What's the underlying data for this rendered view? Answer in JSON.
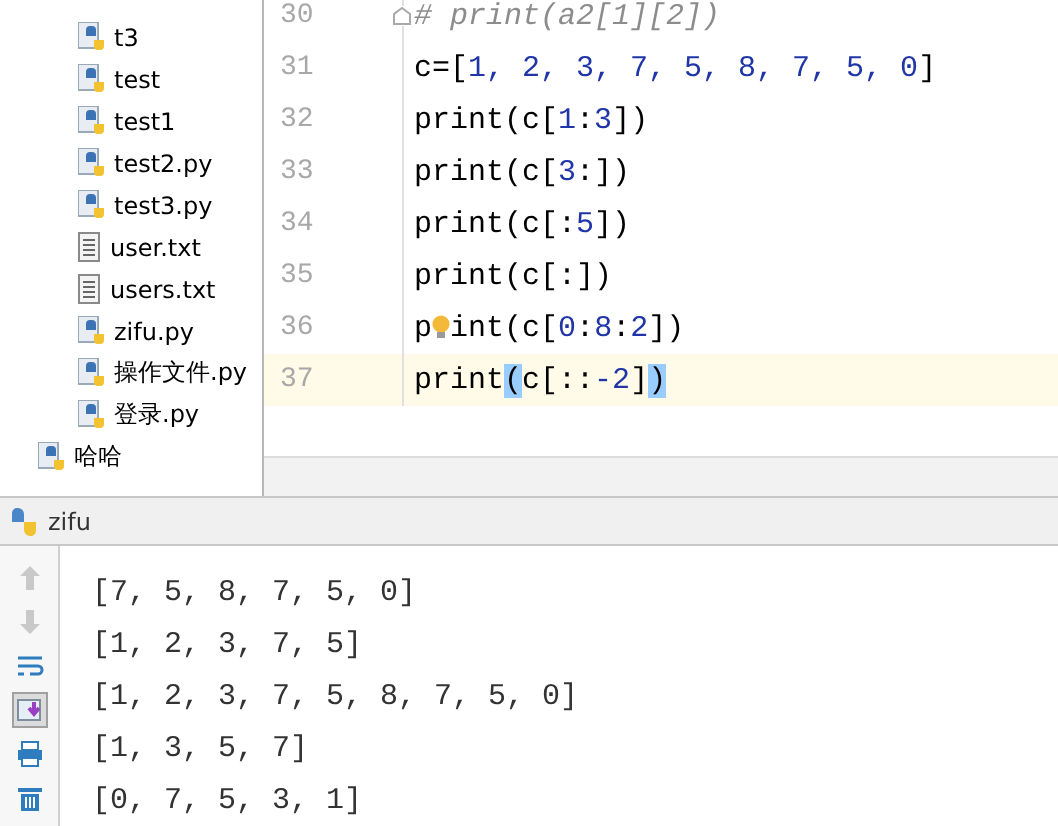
{
  "project_tree": {
    "files": [
      {
        "label": "t3",
        "kind": "python"
      },
      {
        "label": "test",
        "kind": "python"
      },
      {
        "label": "test1",
        "kind": "python"
      },
      {
        "label": "test2.py",
        "kind": "python"
      },
      {
        "label": "test3.py",
        "kind": "python"
      },
      {
        "label": "user.txt",
        "kind": "text"
      },
      {
        "label": "users.txt",
        "kind": "text"
      },
      {
        "label": "zifu.py",
        "kind": "python"
      },
      {
        "label": "操作文件.py",
        "kind": "python"
      },
      {
        "label": "登录.py",
        "kind": "python"
      }
    ],
    "packages": [
      {
        "label": "哈哈",
        "kind": "python"
      }
    ]
  },
  "editor": {
    "lines": [
      {
        "number": "30",
        "current": false,
        "fold": true,
        "tokens": [
          {
            "kind": "comment",
            "text": "# print(a2[1][2])"
          }
        ]
      },
      {
        "number": "31",
        "current": false,
        "fold": false,
        "tokens": [
          {
            "kind": "plain",
            "text": "c=["
          },
          {
            "kind": "number",
            "text": "1, 2, 3, 7, 5, 8, 7, 5, 0"
          },
          {
            "kind": "plain",
            "text": "]"
          }
        ]
      },
      {
        "number": "32",
        "current": false,
        "fold": false,
        "tokens": [
          {
            "kind": "plain",
            "text": "print(c["
          },
          {
            "kind": "number",
            "text": "1"
          },
          {
            "kind": "plain",
            "text": ":"
          },
          {
            "kind": "number",
            "text": "3"
          },
          {
            "kind": "plain",
            "text": "])"
          }
        ]
      },
      {
        "number": "33",
        "current": false,
        "fold": false,
        "tokens": [
          {
            "kind": "plain",
            "text": "print(c["
          },
          {
            "kind": "number",
            "text": "3"
          },
          {
            "kind": "plain",
            "text": ":])"
          }
        ]
      },
      {
        "number": "34",
        "current": false,
        "fold": false,
        "tokens": [
          {
            "kind": "plain",
            "text": "print(c[:"
          },
          {
            "kind": "number",
            "text": "5"
          },
          {
            "kind": "plain",
            "text": "])"
          }
        ]
      },
      {
        "number": "35",
        "current": false,
        "fold": false,
        "tokens": [
          {
            "kind": "plain",
            "text": "print(c[:])"
          }
        ]
      },
      {
        "number": "36",
        "current": false,
        "fold": false,
        "tokens": [
          {
            "kind": "plain",
            "text": "p"
          },
          {
            "kind": "bulb"
          },
          {
            "kind": "plain",
            "text": "int(c["
          },
          {
            "kind": "number",
            "text": "0"
          },
          {
            "kind": "plain",
            "text": ":"
          },
          {
            "kind": "number",
            "text": "8"
          },
          {
            "kind": "plain",
            "text": ":"
          },
          {
            "kind": "number",
            "text": "2"
          },
          {
            "kind": "plain",
            "text": "])"
          }
        ]
      },
      {
        "number": "37",
        "current": true,
        "fold": false,
        "tokens": [
          {
            "kind": "plain",
            "text": "print"
          },
          {
            "kind": "brace",
            "text": "("
          },
          {
            "kind": "plain",
            "text": "c[::"
          },
          {
            "kind": "number",
            "text": "-2"
          },
          {
            "kind": "plain",
            "text": "]"
          },
          {
            "kind": "brace",
            "text": ")"
          }
        ]
      }
    ]
  },
  "run_panel": {
    "tab": "zifu",
    "tools": [
      {
        "kind": "up",
        "selected": false
      },
      {
        "kind": "down",
        "selected": false
      },
      {
        "kind": "wrap",
        "selected": false
      },
      {
        "kind": "scroll",
        "selected": true
      },
      {
        "kind": "print",
        "selected": false
      },
      {
        "kind": "trash",
        "selected": false
      }
    ],
    "output": [
      "[7, 5, 8, 7, 5, 0]",
      "[1, 2, 3, 7, 5]",
      "[1, 2, 3, 7, 5, 8, 7, 5, 0]",
      "[1, 3, 5, 7]",
      "[0, 7, 5, 3, 1]"
    ]
  }
}
